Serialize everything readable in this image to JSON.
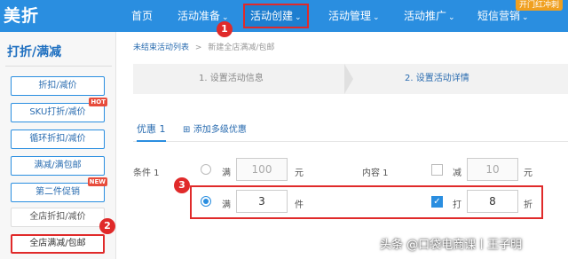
{
  "logo": "美折",
  "nav": {
    "home": "首页",
    "prep": "活动准备",
    "create": "活动创建",
    "manage": "活动管理",
    "promote": "活动推广",
    "sms": "短信营销",
    "promo_badge": "开门红冲刺"
  },
  "badges": {
    "one": "1",
    "two": "2",
    "three": "3"
  },
  "sidebar": {
    "title": "打折/满减",
    "items": [
      {
        "label": "折扣/减价"
      },
      {
        "label": "SKU打折/减价",
        "tag": "HOT"
      },
      {
        "label": "循环折扣/减价"
      },
      {
        "label": "满减/满包邮"
      },
      {
        "label": "第二件促销",
        "tag": "NEW"
      },
      {
        "label": "全店折扣/减价"
      },
      {
        "label": "全店满减/包邮"
      }
    ]
  },
  "breadcrumb": {
    "link": "未结束活动列表",
    "sep": ">",
    "current": "新建全店满减/包邮"
  },
  "steps": {
    "step1": "1. 设置活动信息",
    "step2": "2. 设置活动详情"
  },
  "tabs": {
    "tier1": "优惠 1",
    "add": "添加多级优惠"
  },
  "form": {
    "condition_label": "条件 1",
    "content_label": "内容 1",
    "row1": {
      "man": "满",
      "amount": "100",
      "yuan": "元",
      "jian": "减",
      "discount": "10",
      "yuan2": "元"
    },
    "row2": {
      "man": "满",
      "count": "3",
      "jian_unit": "件",
      "da": "打",
      "zhe_value": "8",
      "zhe": "折"
    }
  },
  "watermark": "头条 @口袋电商课丨王子明",
  "colors": {
    "nav_bg": "#2a8ee0",
    "highlight": "#e02a2a",
    "accent": "#2a6cb0"
  }
}
